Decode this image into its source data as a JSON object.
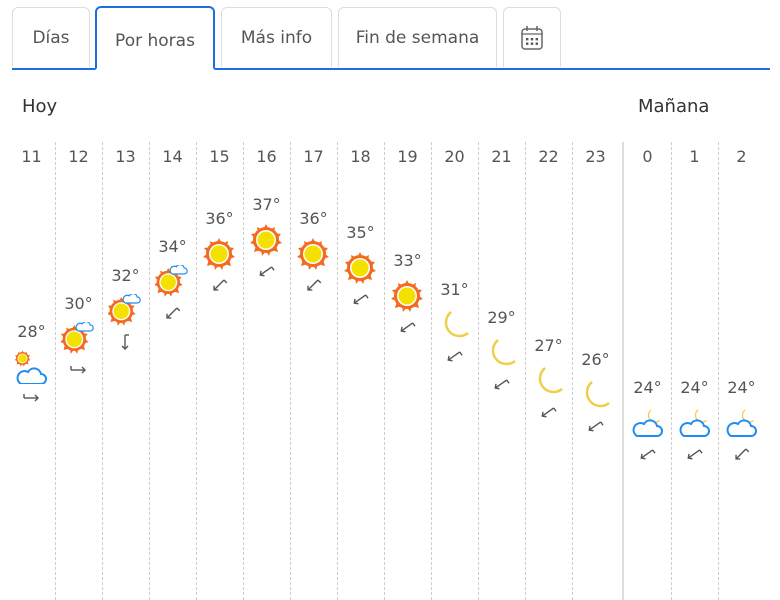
{
  "tabs": [
    {
      "label": "Días"
    },
    {
      "label": "Por horas",
      "active": true
    },
    {
      "label": "Más info"
    },
    {
      "label": "Fin de semana"
    },
    {
      "label": "",
      "icon": "calendar-icon"
    }
  ],
  "days": {
    "today": "Hoy",
    "tomorrow": "Mañana"
  },
  "accent": "#1a6fe0",
  "hours": [
    {
      "hour": "11",
      "temp": "28°",
      "t": 28,
      "icon": "partly-cloudy",
      "wind": 180
    },
    {
      "hour": "12",
      "temp": "30°",
      "t": 30,
      "icon": "sun-cloud",
      "wind": 180
    },
    {
      "hour": "13",
      "temp": "32°",
      "t": 32,
      "icon": "sun-cloud",
      "wind": 270
    },
    {
      "hour": "14",
      "temp": "34°",
      "t": 34,
      "icon": "sun-cloud",
      "wind": -45
    },
    {
      "hour": "15",
      "temp": "36°",
      "t": 36,
      "icon": "sun",
      "wind": -45
    },
    {
      "hour": "16",
      "temp": "37°",
      "t": 37,
      "icon": "sun",
      "wind": -35
    },
    {
      "hour": "17",
      "temp": "36°",
      "t": 36,
      "icon": "sun",
      "wind": -45
    },
    {
      "hour": "18",
      "temp": "35°",
      "t": 35,
      "icon": "sun",
      "wind": -35
    },
    {
      "hour": "19",
      "temp": "33°",
      "t": 33,
      "icon": "sun",
      "wind": -35
    },
    {
      "hour": "20",
      "temp": "31°",
      "t": 31,
      "icon": "moon",
      "wind": -35
    },
    {
      "hour": "21",
      "temp": "29°",
      "t": 29,
      "icon": "moon",
      "wind": -35
    },
    {
      "hour": "22",
      "temp": "27°",
      "t": 27,
      "icon": "moon",
      "wind": -35
    },
    {
      "hour": "23",
      "temp": "26°",
      "t": 26,
      "icon": "moon",
      "wind": -35
    },
    {
      "hour": "0",
      "temp": "24°",
      "t": 24,
      "icon": "cloud-moon",
      "wind": -35
    },
    {
      "hour": "1",
      "temp": "24°",
      "t": 24,
      "icon": "cloud-moon",
      "wind": -35
    },
    {
      "hour": "2",
      "temp": "24°",
      "t": 24,
      "icon": "cloud-moon",
      "wind": -45
    }
  ]
}
